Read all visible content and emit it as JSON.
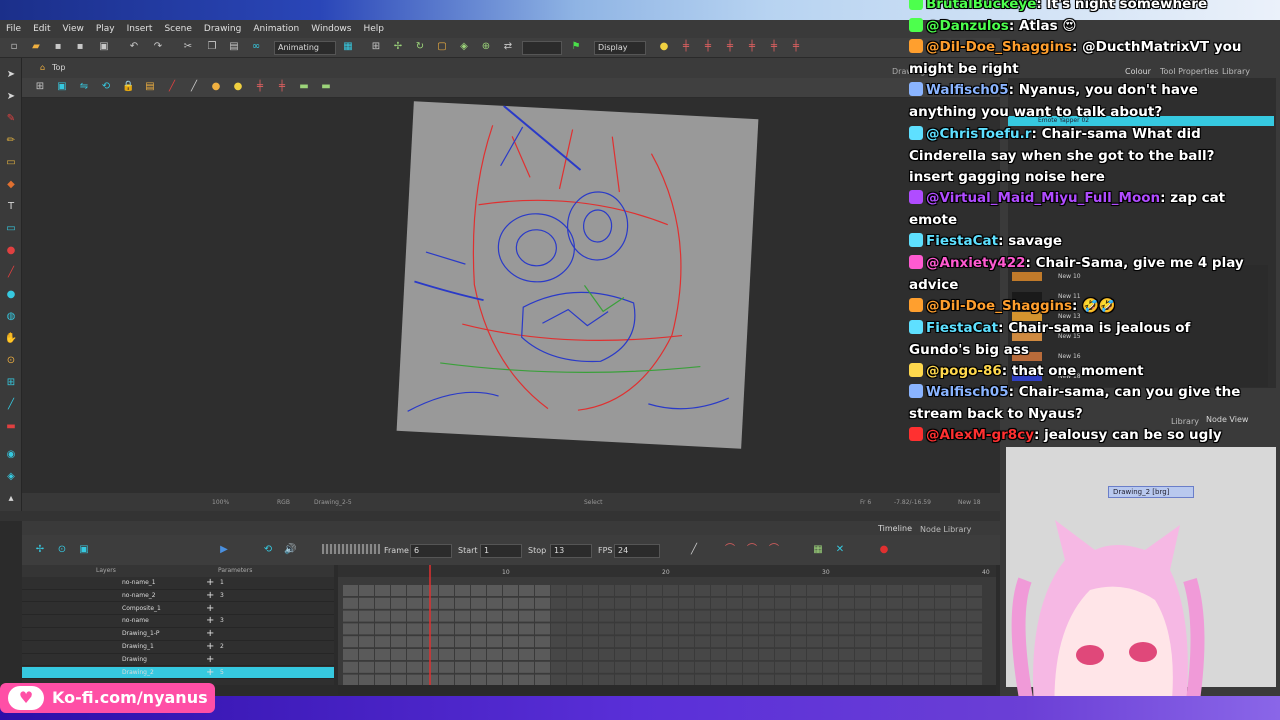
{
  "title_banner": "It's night somewhere",
  "menu": [
    "File",
    "Edit",
    "View",
    "Play",
    "Insert",
    "Scene",
    "Drawing",
    "Animation",
    "Windows",
    "Help"
  ],
  "toolbar": {
    "mode_select": "Animating",
    "display_select": "Display"
  },
  "view": {
    "tab_label": "Top",
    "drawing_tab": "Drawing",
    "status_zoom": "100%",
    "status_rgb": "RGB",
    "status_layer": "Drawing_2-5",
    "status_tool": "Select",
    "status_frame": "Fr 6",
    "status_coords": "-7.82/-16.59",
    "status_new": "New 18"
  },
  "timeline": {
    "tab": "Timeline",
    "node_library_tab": "Node Library",
    "frame_label": "Frame",
    "frame_value": "6",
    "start_label": "Start",
    "start_value": "1",
    "stop_label": "Stop",
    "stop_value": "13",
    "fps_label": "FPS",
    "fps_value": "24",
    "layers_header": "Layers",
    "params_header": "Parameters",
    "ruler": [
      "10",
      "20",
      "30",
      "40"
    ],
    "layers": [
      {
        "name": "no-name_1",
        "val": "1"
      },
      {
        "name": "no-name_2",
        "val": "3"
      },
      {
        "name": "Composite_1",
        "val": ""
      },
      {
        "name": "no-name",
        "val": "3"
      },
      {
        "name": "Drawing_1-P",
        "val": ""
      },
      {
        "name": "Drawing_1",
        "val": "2"
      },
      {
        "name": "Drawing",
        "val": ""
      },
      {
        "name": "Drawing_2",
        "val": "5"
      }
    ]
  },
  "right_panel": {
    "tabs": [
      "Colour",
      "Tool Properties",
      "Library"
    ],
    "palette_name": "Emote Yapper 02",
    "swatches": [
      {
        "label": "New 10",
        "color": "#c07a2a"
      },
      {
        "label": "New 11",
        "color": "#1a1a1a"
      },
      {
        "label": "New 13",
        "color": "#d4942e"
      },
      {
        "label": "New 15",
        "color": "#d08a40"
      },
      {
        "label": "New 16",
        "color": "#b86b3a"
      },
      {
        "label": "New 18",
        "color": "#2f3fc2"
      }
    ],
    "bottom_tabs": [
      "Library",
      "Node View"
    ],
    "node_label": "Drawing_2 [brg]"
  },
  "chat": [
    {
      "user": "BrutalBuckeye",
      "text": "It's night somewhere",
      "color": "#4dff4d"
    },
    {
      "user": "@Danzulos",
      "text": "Atlas 😍",
      "color": "#4dff4d"
    },
    {
      "user": "@Dil-Doe_Shaggins",
      "text": "@DucthMatrixVT you might be right",
      "color": "#ff9f2e"
    },
    {
      "user": "Walfisch05",
      "text": "Nyanus, you don't have anything you want to talk about?",
      "color": "#8ab4ff"
    },
    {
      "user": "@ChrisToefu.r",
      "text": "Chair-sama What did Cinderella say when she got to the ball? insert gagging noise here",
      "color": "#5ee0ff"
    },
    {
      "user": "@Virtual_Maid_Miyu_Full_Moon",
      "text": "zap cat emote",
      "color": "#b04cff"
    },
    {
      "user": "FiestaCat",
      "text": "savage",
      "color": "#5ee0ff"
    },
    {
      "user": "@Anxiety422",
      "text": "Chair-Sama, give me 4 play advice",
      "color": "#ff5ad1"
    },
    {
      "user": "@Dil-Doe_Shaggins",
      "text": "🤣🤣",
      "color": "#ff9f2e"
    },
    {
      "user": "FiestaCat",
      "text": "Chair-sama is jealous of Gundo's big ass",
      "color": "#5ee0ff"
    },
    {
      "user": "@pogo-86",
      "text": "that one moment",
      "color": "#ffd84d"
    },
    {
      "user": "Walfisch05",
      "text": "Chair-sama, can you give the stream back to Nyaus?",
      "color": "#8ab4ff"
    },
    {
      "user": "@AlexM-gr8cy",
      "text": "jealousy can be so ugly",
      "color": "#ff3030"
    }
  ],
  "kofi": "Ko-fi.com/nyanus",
  "colors": {
    "accent_cyan": "#36c9e0",
    "accent_pink": "#ff4fa6",
    "timeline_red": "#e03030"
  }
}
